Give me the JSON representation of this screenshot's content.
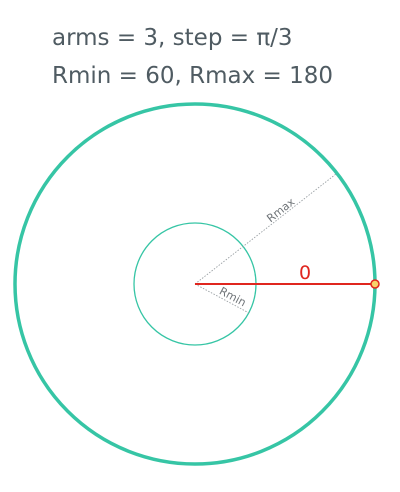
{
  "params": {
    "line1": "arms = 3, step = π/3",
    "line2": "Rmin = 60, Rmax = 180"
  },
  "diagram": {
    "rmax_label": "Rmax",
    "rmin_label": "Rmin",
    "arm_label": "0",
    "colors": {
      "circle": "#36c5a5",
      "arm": "#e0261f",
      "handle_fill": "#f7d36b",
      "guide": "#9aa0a4",
      "guide_text": "#6f7478",
      "caption": "#4f5b62"
    }
  }
}
